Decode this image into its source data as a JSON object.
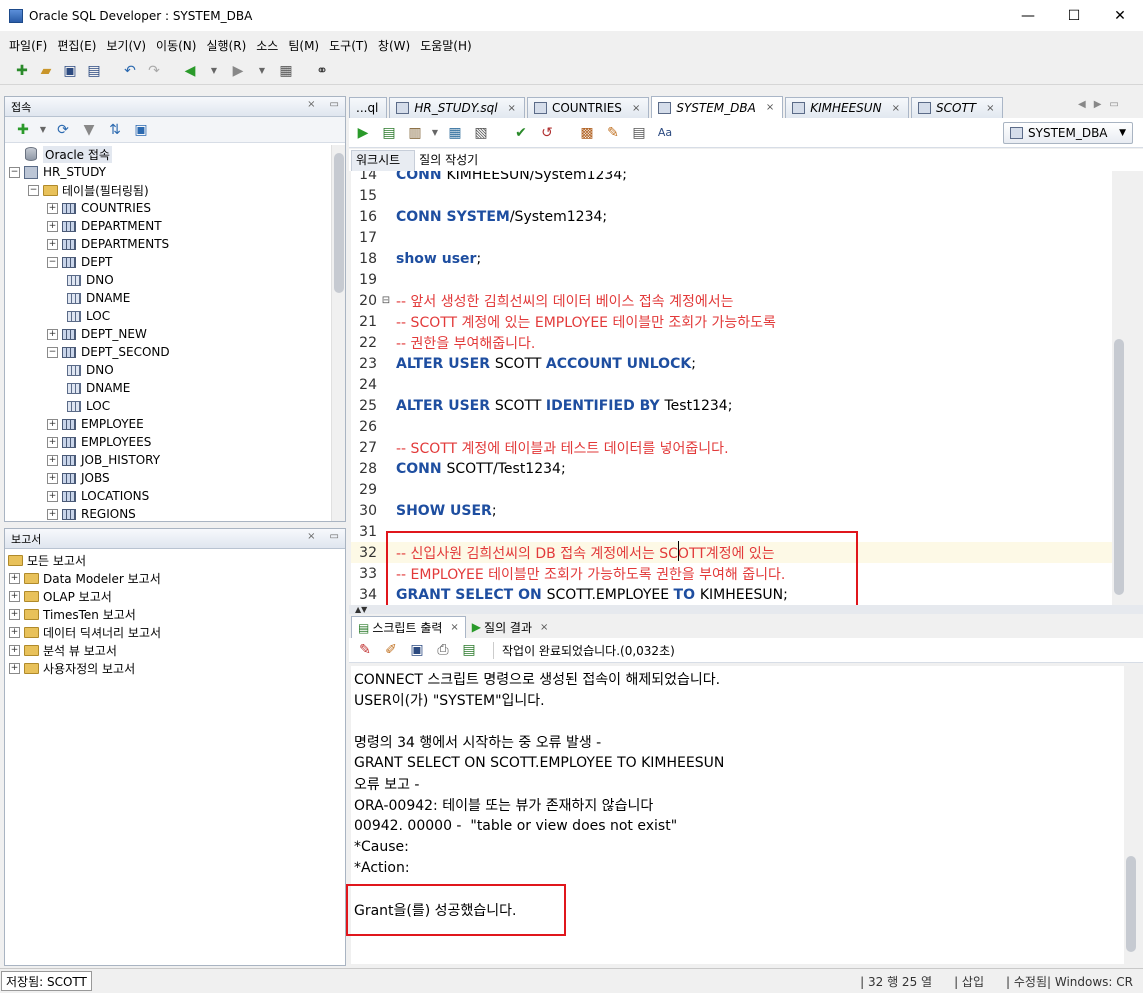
{
  "window": {
    "title": "Oracle SQL Developer : SYSTEM_DBA",
    "controls": [
      "—",
      "☐",
      "✕"
    ]
  },
  "menu": [
    "파일(F)",
    "편집(E)",
    "보기(V)",
    "이동(N)",
    "실행(R)",
    "소스",
    "팀(M)",
    "도구(T)",
    "창(W)",
    "도움말(H)"
  ],
  "connections_panel": {
    "title": "접속",
    "tree": [
      {
        "label": "Oracle 접속",
        "level": 0,
        "icon": "db-icon",
        "toggle": "",
        "highlight": true
      },
      {
        "label": "HR_STUDY",
        "level": 0,
        "icon": "connection-icon",
        "toggle": "−"
      },
      {
        "label": "테이블(필터링됨)",
        "level": 1,
        "icon": "folder-icon",
        "toggle": "−"
      },
      {
        "label": "COUNTRIES",
        "level": 2,
        "icon": "table-icon",
        "toggle": "+"
      },
      {
        "label": "DEPARTMENT",
        "level": 2,
        "icon": "table-icon",
        "toggle": "+"
      },
      {
        "label": "DEPARTMENTS",
        "level": 2,
        "icon": "table-icon",
        "toggle": "+"
      },
      {
        "label": "DEPT",
        "level": 2,
        "icon": "table-icon",
        "toggle": "−"
      },
      {
        "label": "DNO",
        "level": 3,
        "icon": "column-icon",
        "toggle": ""
      },
      {
        "label": "DNAME",
        "level": 3,
        "icon": "column-icon",
        "toggle": ""
      },
      {
        "label": "LOC",
        "level": 3,
        "icon": "column-icon",
        "toggle": ""
      },
      {
        "label": "DEPT_NEW",
        "level": 2,
        "icon": "table-icon",
        "toggle": "+"
      },
      {
        "label": "DEPT_SECOND",
        "level": 2,
        "icon": "table-icon",
        "toggle": "−"
      },
      {
        "label": "DNO",
        "level": 3,
        "icon": "column-icon",
        "toggle": ""
      },
      {
        "label": "DNAME",
        "level": 3,
        "icon": "column-icon",
        "toggle": ""
      },
      {
        "label": "LOC",
        "level": 3,
        "icon": "column-icon",
        "toggle": ""
      },
      {
        "label": "EMPLOYEE",
        "level": 2,
        "icon": "table-icon",
        "toggle": "+"
      },
      {
        "label": "EMPLOYEES",
        "level": 2,
        "icon": "table-icon",
        "toggle": "+"
      },
      {
        "label": "JOB_HISTORY",
        "level": 2,
        "icon": "table-icon",
        "toggle": "+"
      },
      {
        "label": "JOBS",
        "level": 2,
        "icon": "table-icon",
        "toggle": "+"
      },
      {
        "label": "LOCATIONS",
        "level": 2,
        "icon": "table-icon",
        "toggle": "+"
      },
      {
        "label": "REGIONS",
        "level": 2,
        "icon": "table-icon",
        "toggle": "+"
      }
    ]
  },
  "reports_panel": {
    "title": "보고서",
    "tree": [
      {
        "label": "모든 보고서",
        "level": 0,
        "toggle": ""
      },
      {
        "label": "Data Modeler 보고서",
        "level": 1,
        "toggle": "+"
      },
      {
        "label": "OLAP 보고서",
        "level": 1,
        "toggle": "+"
      },
      {
        "label": "TimesTen 보고서",
        "level": 1,
        "toggle": "+"
      },
      {
        "label": "데이터 딕셔너리 보고서",
        "level": 1,
        "toggle": "+"
      },
      {
        "label": "분석 뷰 보고서",
        "level": 1,
        "toggle": "+"
      },
      {
        "label": "사용자정의 보고서",
        "level": 1,
        "toggle": "+"
      }
    ]
  },
  "doc_tabs": [
    {
      "label": "...ql",
      "style": "normal",
      "active": false
    },
    {
      "label": "HR_STUDY.sql",
      "style": "italic",
      "active": false,
      "close": "×"
    },
    {
      "label": "COUNTRIES",
      "style": "normal",
      "active": false,
      "close": "×"
    },
    {
      "label": "SYSTEM_DBA",
      "style": "italic",
      "active": true,
      "close": "×"
    },
    {
      "label": "KIMHEESUN",
      "style": "italic",
      "active": false,
      "close": "×"
    },
    {
      "label": "SCOTT",
      "style": "italic",
      "active": false,
      "close": "×"
    }
  ],
  "connection_selector": "SYSTEM_DBA",
  "sub_tabs": [
    "워크시트",
    "질의 작성기"
  ],
  "editor": {
    "lines": [
      {
        "n": "14",
        "parts": [
          {
            "t": "CONN ",
            "c": "kw"
          },
          {
            "t": "KIMHEESUN/System1234;",
            "c": ""
          }
        ]
      },
      {
        "n": "15",
        "parts": []
      },
      {
        "n": "16",
        "parts": [
          {
            "t": "CONN SYSTEM",
            "c": "kw"
          },
          {
            "t": "/System1234;",
            "c": ""
          }
        ]
      },
      {
        "n": "17",
        "parts": []
      },
      {
        "n": "18",
        "parts": [
          {
            "t": "show user",
            "c": "kw"
          },
          {
            "t": ";",
            "c": ""
          }
        ]
      },
      {
        "n": "19",
        "parts": []
      },
      {
        "n": "20",
        "fold": "⊟",
        "parts": [
          {
            "t": "-- 앞서 생성한 김희선씨의 데이터 베이스 접속 계정에서는",
            "c": "cmt"
          }
        ]
      },
      {
        "n": "21",
        "parts": [
          {
            "t": "-- SCOTT 계정에 있는 EMPLOYEE 테이블만 조회가 가능하도록",
            "c": "cmt"
          }
        ]
      },
      {
        "n": "22",
        "parts": [
          {
            "t": "-- 권한을 부여해줍니다.",
            "c": "cmt"
          }
        ]
      },
      {
        "n": "23",
        "parts": [
          {
            "t": "ALTER USER ",
            "c": "kw"
          },
          {
            "t": "SCOTT ",
            "c": ""
          },
          {
            "t": "ACCOUNT UNLOCK",
            "c": "kw"
          },
          {
            "t": ";",
            "c": ""
          }
        ]
      },
      {
        "n": "24",
        "parts": []
      },
      {
        "n": "25",
        "parts": [
          {
            "t": "ALTER USER ",
            "c": "kw"
          },
          {
            "t": "SCOTT ",
            "c": ""
          },
          {
            "t": "IDENTIFIED BY ",
            "c": "kw"
          },
          {
            "t": "Test1234;",
            "c": ""
          }
        ]
      },
      {
        "n": "26",
        "parts": []
      },
      {
        "n": "27",
        "parts": [
          {
            "t": "-- SCOTT 계정에 테이블과 테스트 데이터를 넣어줍니다.",
            "c": "cmt"
          }
        ]
      },
      {
        "n": "28",
        "parts": [
          {
            "t": "CONN ",
            "c": "kw"
          },
          {
            "t": "SCOTT/Test1234;",
            "c": ""
          }
        ]
      },
      {
        "n": "29",
        "parts": []
      },
      {
        "n": "30",
        "parts": [
          {
            "t": "SHOW USER",
            "c": "kw"
          },
          {
            "t": ";",
            "c": ""
          }
        ]
      },
      {
        "n": "31",
        "parts": []
      },
      {
        "n": "32",
        "current": true,
        "parts": [
          {
            "t": "-- 신입사원 김희선씨의 DB 접속 계정에서는 SCOTT계정에 있는",
            "c": "cmt"
          }
        ]
      },
      {
        "n": "33",
        "parts": [
          {
            "t": "-- EMPLOYEE 테이블만 조회가 가능하도록 권한을 부여해 줍니다.",
            "c": "cmt"
          }
        ]
      },
      {
        "n": "34",
        "parts": [
          {
            "t": "GRANT SELECT ON ",
            "c": "kw"
          },
          {
            "t": "SCOTT.EMPLOYEE ",
            "c": ""
          },
          {
            "t": "TO ",
            "c": "kw"
          },
          {
            "t": "KIMHEESUN;",
            "c": ""
          }
        ]
      }
    ]
  },
  "output_tabs": [
    {
      "label": "스크립트 출력",
      "active": true,
      "close": "×"
    },
    {
      "label": "질의 결과",
      "active": false,
      "close": "×"
    }
  ],
  "output_status": "작업이 완료되었습니다.(0,032초)",
  "output_lines": [
    "CONNECT 스크립트 명령으로 생성된 접속이 해제되었습니다.",
    "USER이(가) \"SYSTEM\"입니다.",
    "",
    "명령의 34 행에서 시작하는 중 오류 발생 -",
    "GRANT SELECT ON SCOTT.EMPLOYEE TO KIMHEESUN",
    "오류 보고 -",
    "ORA-00942: 테이블 또는 뷰가 존재하지 않습니다",
    "00942. 00000 -  \"table or view does not exist\"",
    "*Cause:",
    "*Action:",
    "",
    "Grant을(를) 성공했습니다."
  ],
  "statusbar": {
    "left": "저장됨: SCOTT",
    "position": "| 32 행 25 열",
    "insert": "| 삽입",
    "modified": "| 수정됨| Windows: CR"
  },
  "colors": {
    "keyword": "#1e4ea0",
    "comment": "#e23a3a",
    "highlight_box": "#e0161c"
  }
}
